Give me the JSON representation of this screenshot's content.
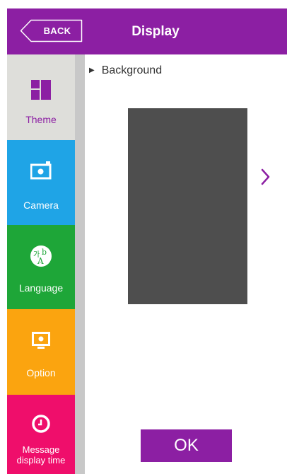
{
  "header": {
    "back_label": "BACK",
    "title": "Display"
  },
  "sidebar": {
    "items": [
      {
        "label": "Theme",
        "icon": "theme-icon",
        "color": "#dededa",
        "selected": true
      },
      {
        "label": "Camera",
        "icon": "camera-icon",
        "color": "#1fa4e6"
      },
      {
        "label": "Language",
        "icon": "language-icon",
        "color": "#1ea638"
      },
      {
        "label": "Option",
        "icon": "monitor-icon",
        "color": "#fba40f"
      },
      {
        "label_line1": "Message",
        "label_line2": "display time",
        "icon": "clock-icon",
        "color": "#ef0e6b"
      }
    ]
  },
  "main": {
    "section_label": "Background",
    "ok_label": "OK"
  },
  "colors": {
    "accent": "#8c1fa3",
    "preview": "#4e4e4e"
  }
}
